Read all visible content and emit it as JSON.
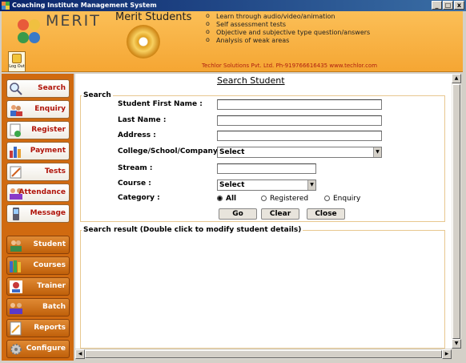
{
  "window": {
    "title": "Coaching Institute Management System",
    "min": "_",
    "max": "□",
    "close": "x"
  },
  "header": {
    "logo_text": "MERIT STU",
    "logout_label": "Log Out",
    "brand": "Merit Students",
    "features": [
      "Learn through audio/video/animation",
      "Self assessment tests",
      "Objective and subjective type question/answers",
      "Analysis of weak areas"
    ],
    "company": "Techlor Solutions Pvt. Ltd. Ph-919766616435 www.techlor.com"
  },
  "sidebar": {
    "top_items": [
      {
        "label": "Search",
        "icon": "magnifier-icon"
      },
      {
        "label": "Enquiry",
        "icon": "people-icon"
      },
      {
        "label": "Register",
        "icon": "register-icon"
      },
      {
        "label": "Payment",
        "icon": "chart-icon"
      },
      {
        "label": "Tests",
        "icon": "pencil-icon"
      },
      {
        "label": "Attendance",
        "icon": "group-icon"
      },
      {
        "label": "Message",
        "icon": "phone-icon"
      }
    ],
    "bottom_items": [
      {
        "label": "Student",
        "icon": "students-icon"
      },
      {
        "label": "Courses",
        "icon": "books-icon"
      },
      {
        "label": "Trainer",
        "icon": "trainer-icon"
      },
      {
        "label": "Batch",
        "icon": "batch-icon"
      },
      {
        "label": "Reports",
        "icon": "reports-icon"
      },
      {
        "label": "Configure",
        "icon": "gear-icon"
      }
    ]
  },
  "main": {
    "title": "Search Student",
    "search_legend": "Search",
    "fields": {
      "first_name": {
        "label": "Student First Name :",
        "value": ""
      },
      "last_name": {
        "label": "Last Name :",
        "value": ""
      },
      "address": {
        "label": "Address :",
        "value": ""
      },
      "college": {
        "label": "College/School/Company :",
        "value": "Select"
      },
      "stream": {
        "label": "Stream :",
        "value": ""
      },
      "course": {
        "label": "Course :",
        "value": "Select"
      },
      "category": {
        "label": "Category :"
      }
    },
    "category_options": [
      "All",
      "Registered",
      "Enquiry"
    ],
    "category_selected": "All",
    "buttons": {
      "go": "Go",
      "clear": "Clear",
      "close": "Close"
    },
    "result_legend": "Search result (Double click to modify student details)"
  },
  "colors": {
    "header": "#f5a633",
    "sidebar": "#d06a10",
    "accent_text": "#b0140a",
    "border": "#e8c890"
  }
}
